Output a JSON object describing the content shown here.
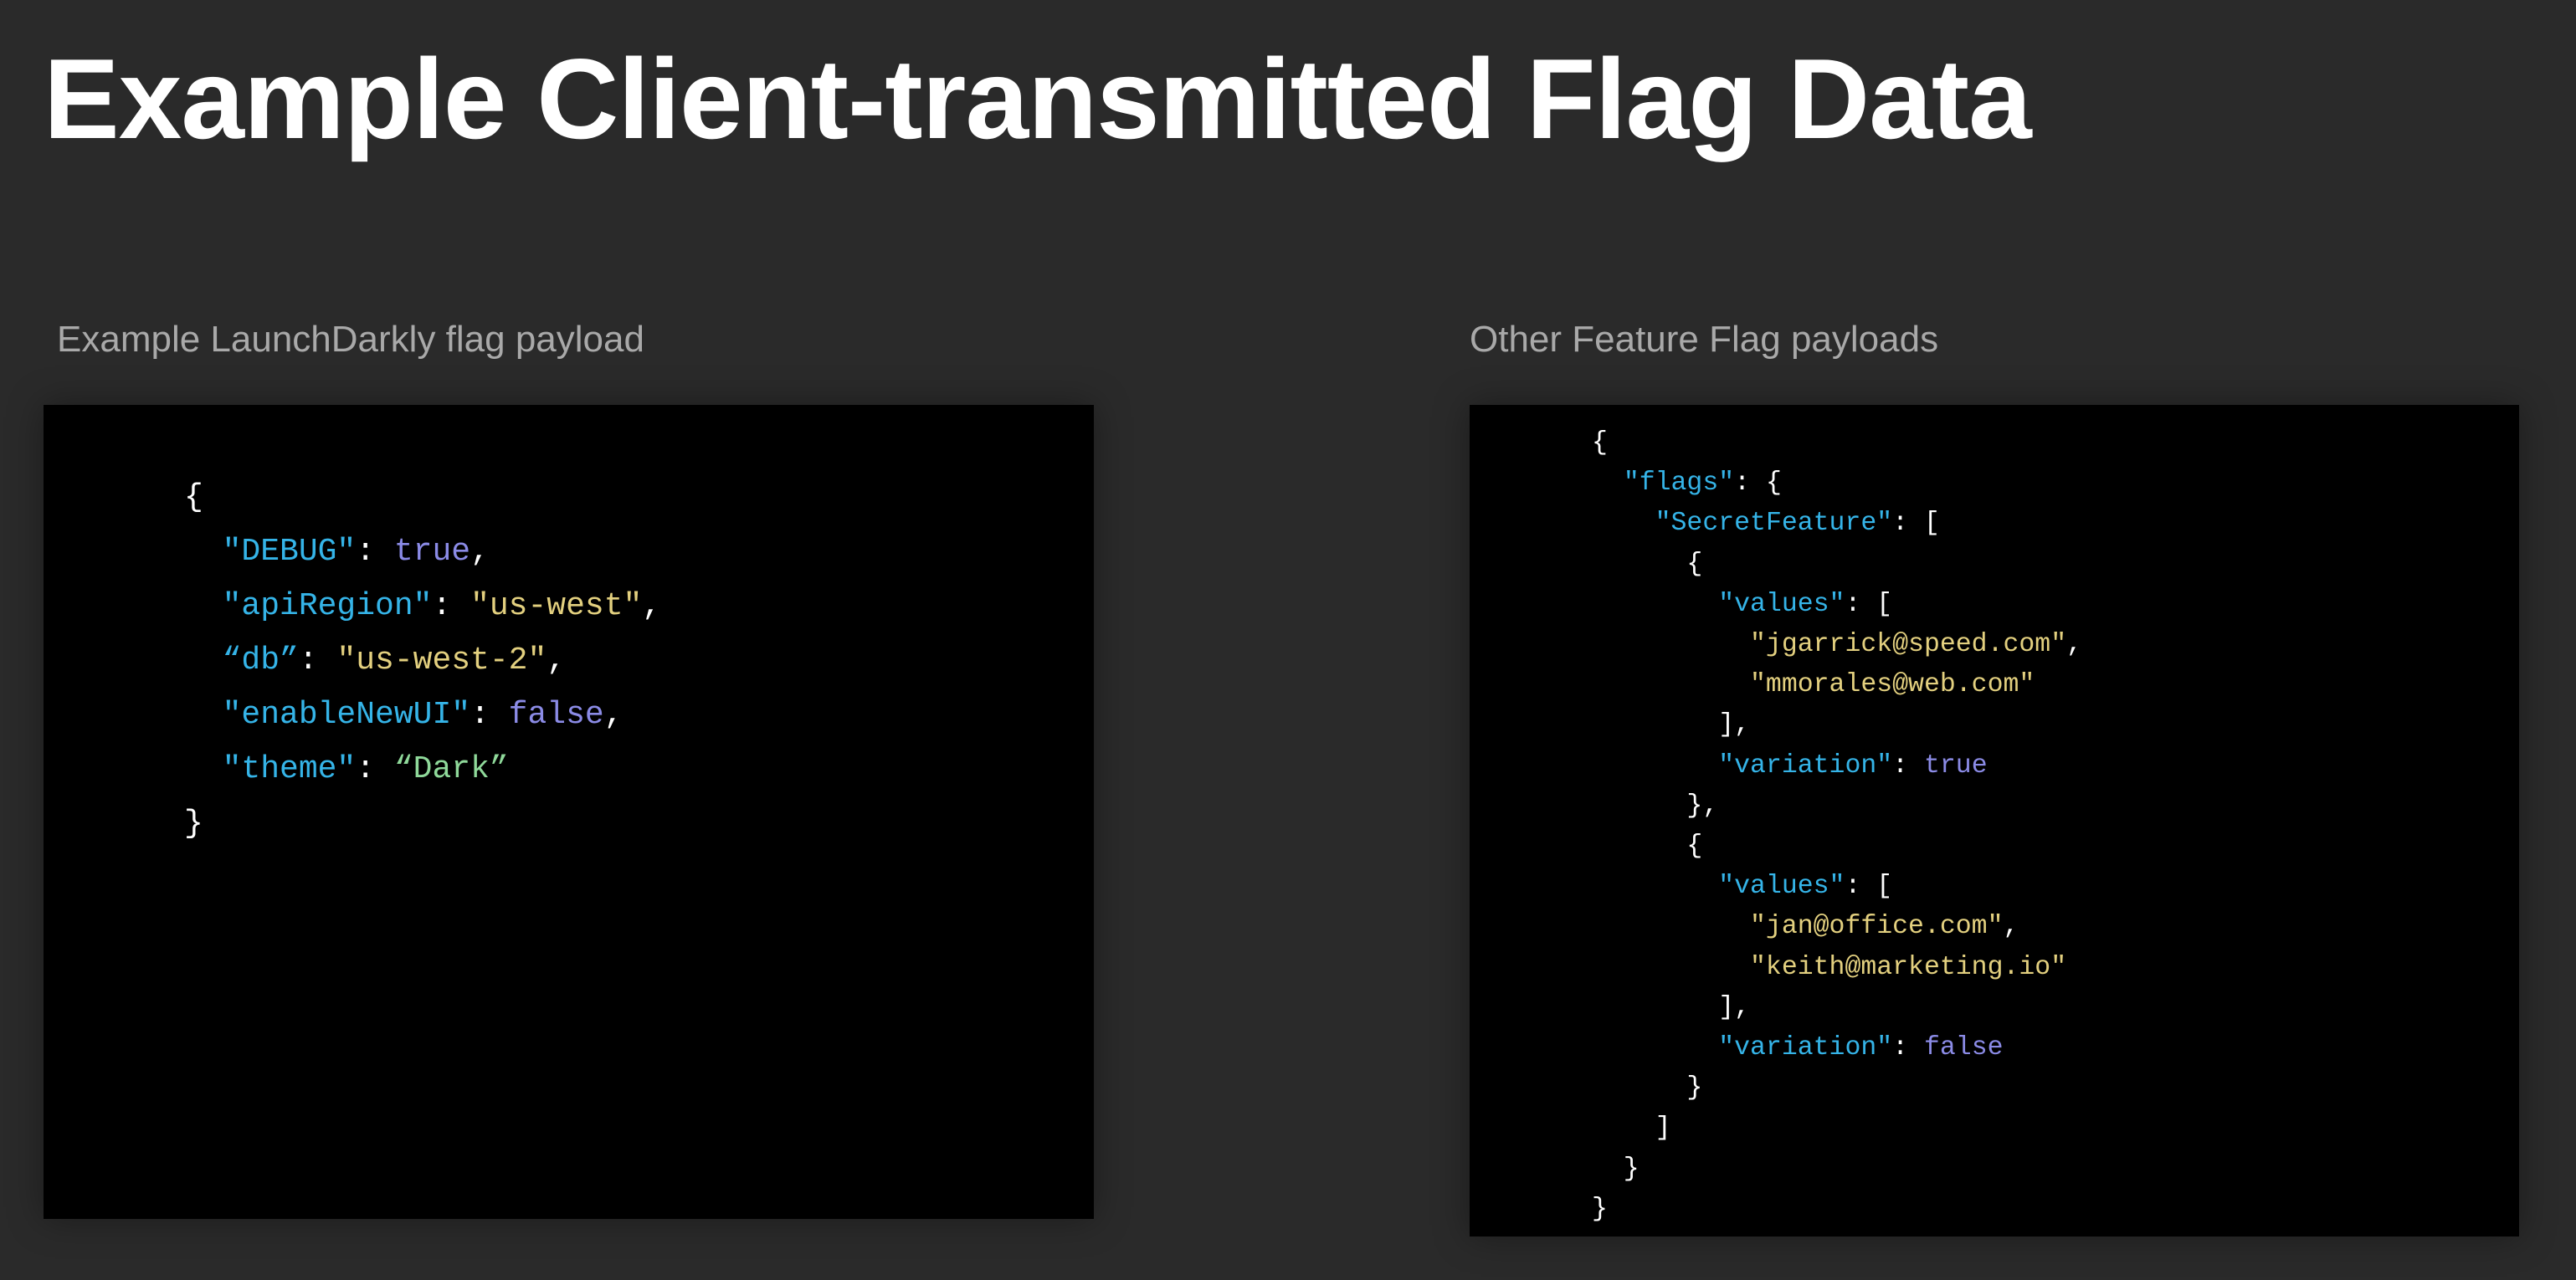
{
  "title": "Example Client-transmitted Flag Data",
  "left_panel": {
    "caption": "Example LaunchDarkly flag payload",
    "lines": [
      [
        {
          "t": "{",
          "c": "p"
        }
      ],
      [
        {
          "t": "  ",
          "c": "p"
        },
        {
          "t": "\"DEBUG\"",
          "c": "k"
        },
        {
          "t": ": ",
          "c": "p"
        },
        {
          "t": "true",
          "c": "b"
        },
        {
          "t": ",",
          "c": "p"
        }
      ],
      [
        {
          "t": "  ",
          "c": "p"
        },
        {
          "t": "\"apiRegion\"",
          "c": "k"
        },
        {
          "t": ": ",
          "c": "p"
        },
        {
          "t": "\"us-west\"",
          "c": "s"
        },
        {
          "t": ",",
          "c": "p"
        }
      ],
      [
        {
          "t": "  ",
          "c": "p"
        },
        {
          "t": "“db”",
          "c": "k"
        },
        {
          "t": ": ",
          "c": "p"
        },
        {
          "t": "\"us-west-2\"",
          "c": "s"
        },
        {
          "t": ",",
          "c": "p"
        }
      ],
      [
        {
          "t": "  ",
          "c": "p"
        },
        {
          "t": "\"enableNewUI\"",
          "c": "k"
        },
        {
          "t": ": ",
          "c": "p"
        },
        {
          "t": "false",
          "c": "b"
        },
        {
          "t": ",",
          "c": "p"
        }
      ],
      [
        {
          "t": "  ",
          "c": "p"
        },
        {
          "t": "\"theme\"",
          "c": "k"
        },
        {
          "t": ": ",
          "c": "p"
        },
        {
          "t": "“Dark”",
          "c": "g"
        }
      ],
      [
        {
          "t": "}",
          "c": "p"
        }
      ]
    ]
  },
  "right_panel": {
    "caption": "Other Feature Flag payloads",
    "lines": [
      [
        {
          "t": "{",
          "c": "p"
        }
      ],
      [
        {
          "t": "  ",
          "c": "p"
        },
        {
          "t": "\"flags\"",
          "c": "k"
        },
        {
          "t": ": {",
          "c": "p"
        }
      ],
      [
        {
          "t": "    ",
          "c": "p"
        },
        {
          "t": "\"SecretFeature\"",
          "c": "k"
        },
        {
          "t": ": [",
          "c": "p"
        }
      ],
      [
        {
          "t": "      {",
          "c": "p"
        }
      ],
      [
        {
          "t": "        ",
          "c": "p"
        },
        {
          "t": "\"values\"",
          "c": "k"
        },
        {
          "t": ": [",
          "c": "p"
        }
      ],
      [
        {
          "t": "          ",
          "c": "p"
        },
        {
          "t": "\"jgarrick@speed.com\"",
          "c": "s"
        },
        {
          "t": ",",
          "c": "p"
        }
      ],
      [
        {
          "t": "          ",
          "c": "p"
        },
        {
          "t": "\"mmorales@web.com\"",
          "c": "s"
        }
      ],
      [
        {
          "t": "        ],",
          "c": "p"
        }
      ],
      [
        {
          "t": "        ",
          "c": "p"
        },
        {
          "t": "\"variation\"",
          "c": "k"
        },
        {
          "t": ": ",
          "c": "p"
        },
        {
          "t": "true",
          "c": "b"
        }
      ],
      [
        {
          "t": "      },",
          "c": "p"
        }
      ],
      [
        {
          "t": "      {",
          "c": "p"
        }
      ],
      [
        {
          "t": "        ",
          "c": "p"
        },
        {
          "t": "\"values\"",
          "c": "k"
        },
        {
          "t": ": [",
          "c": "p"
        }
      ],
      [
        {
          "t": "          ",
          "c": "p"
        },
        {
          "t": "\"jan@office.com\"",
          "c": "s"
        },
        {
          "t": ",",
          "c": "p"
        }
      ],
      [
        {
          "t": "          ",
          "c": "p"
        },
        {
          "t": "\"keith@marketing.io\"",
          "c": "s"
        }
      ],
      [
        {
          "t": "        ],",
          "c": "p"
        }
      ],
      [
        {
          "t": "        ",
          "c": "p"
        },
        {
          "t": "\"variation\"",
          "c": "k"
        },
        {
          "t": ": ",
          "c": "p"
        },
        {
          "t": "false",
          "c": "b"
        }
      ],
      [
        {
          "t": "      }",
          "c": "p"
        }
      ],
      [
        {
          "t": "    ]",
          "c": "p"
        }
      ],
      [
        {
          "t": "  }",
          "c": "p"
        }
      ],
      [
        {
          "t": "}",
          "c": "p"
        }
      ]
    ]
  },
  "colors": {
    "background": "#2a2a2a",
    "panel": "#000000",
    "key": "#35b4e8",
    "string": "#e3d07f",
    "boolean": "#8b8be6",
    "theme_value": "#8fd99a",
    "caption": "#a9a9a9",
    "title": "#ffffff"
  }
}
